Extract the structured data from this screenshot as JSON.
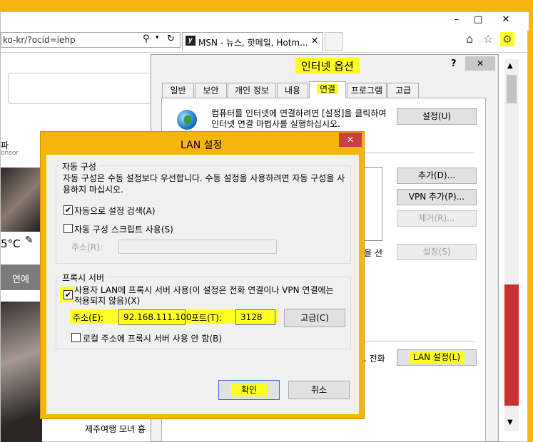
{
  "browser": {
    "address": "ko-kr/?ocid=iehp",
    "tab_title": "MSN - 뉴스, 핫메일, Hotm...",
    "window_controls": [
      "–",
      "□",
      "✕"
    ]
  },
  "background_page": {
    "text_partial_1": "파",
    "text_partial_2": "onsor",
    "weather": "5°C",
    "nav_item": "연예",
    "headline": "제주여행 모녀 흉"
  },
  "internet_options": {
    "title": "인터넷 옵션",
    "help": "?",
    "tabs": [
      "일반",
      "보안",
      "개인 정보",
      "내용",
      "연결",
      "프로그램",
      "고급"
    ],
    "active_tab": "연결",
    "setup_text": "컴퓨터를 인터넷에 연결하려면 [설정]을 클릭하여 인터넷 연결 마법사를 실행하십시오.",
    "setup_button": "설정(U)",
    "add_button": "추가(D)...",
    "add_vpn_button": "VPN 추가(P)...",
    "remove_button": "제거(R)...",
    "settings_button": "설정(S)",
    "partial_label_1": "을 선",
    "partial_label_2": ". 전화",
    "lan_button": "LAN 설정(L)"
  },
  "lan_dialog": {
    "title": "LAN 설정",
    "auto_config": {
      "label": "자동 구성",
      "description": "자동 구성은 수동 설정보다 우선합니다. 수동 설정을 사용하려면 자동 구성을 사용하지 마십시오.",
      "auto_detect_label": "자동으로 설정 검색(A)",
      "auto_detect_checked": true,
      "script_label": "자동 구성 스크립트 사용(S)",
      "script_checked": false,
      "address_label": "주소(R):",
      "address_value": ""
    },
    "proxy": {
      "label": "프록시 서버",
      "use_proxy_label": "사용자 LAN에 프록시 서버 사용(이 설정은 전화 연결이나 VPN 연결에는 적용되지 않음)(X)",
      "use_proxy_checked": true,
      "address_label": "주소(E):",
      "address_value": "92.168.111.100",
      "port_label": "포트(T):",
      "port_value": "3128",
      "advanced_button": "고급(C)",
      "bypass_label": "로컬 주소에 프록시 서버 사용 안 함(B)",
      "bypass_checked": false
    },
    "ok_button": "확인",
    "cancel_button": "취소"
  }
}
